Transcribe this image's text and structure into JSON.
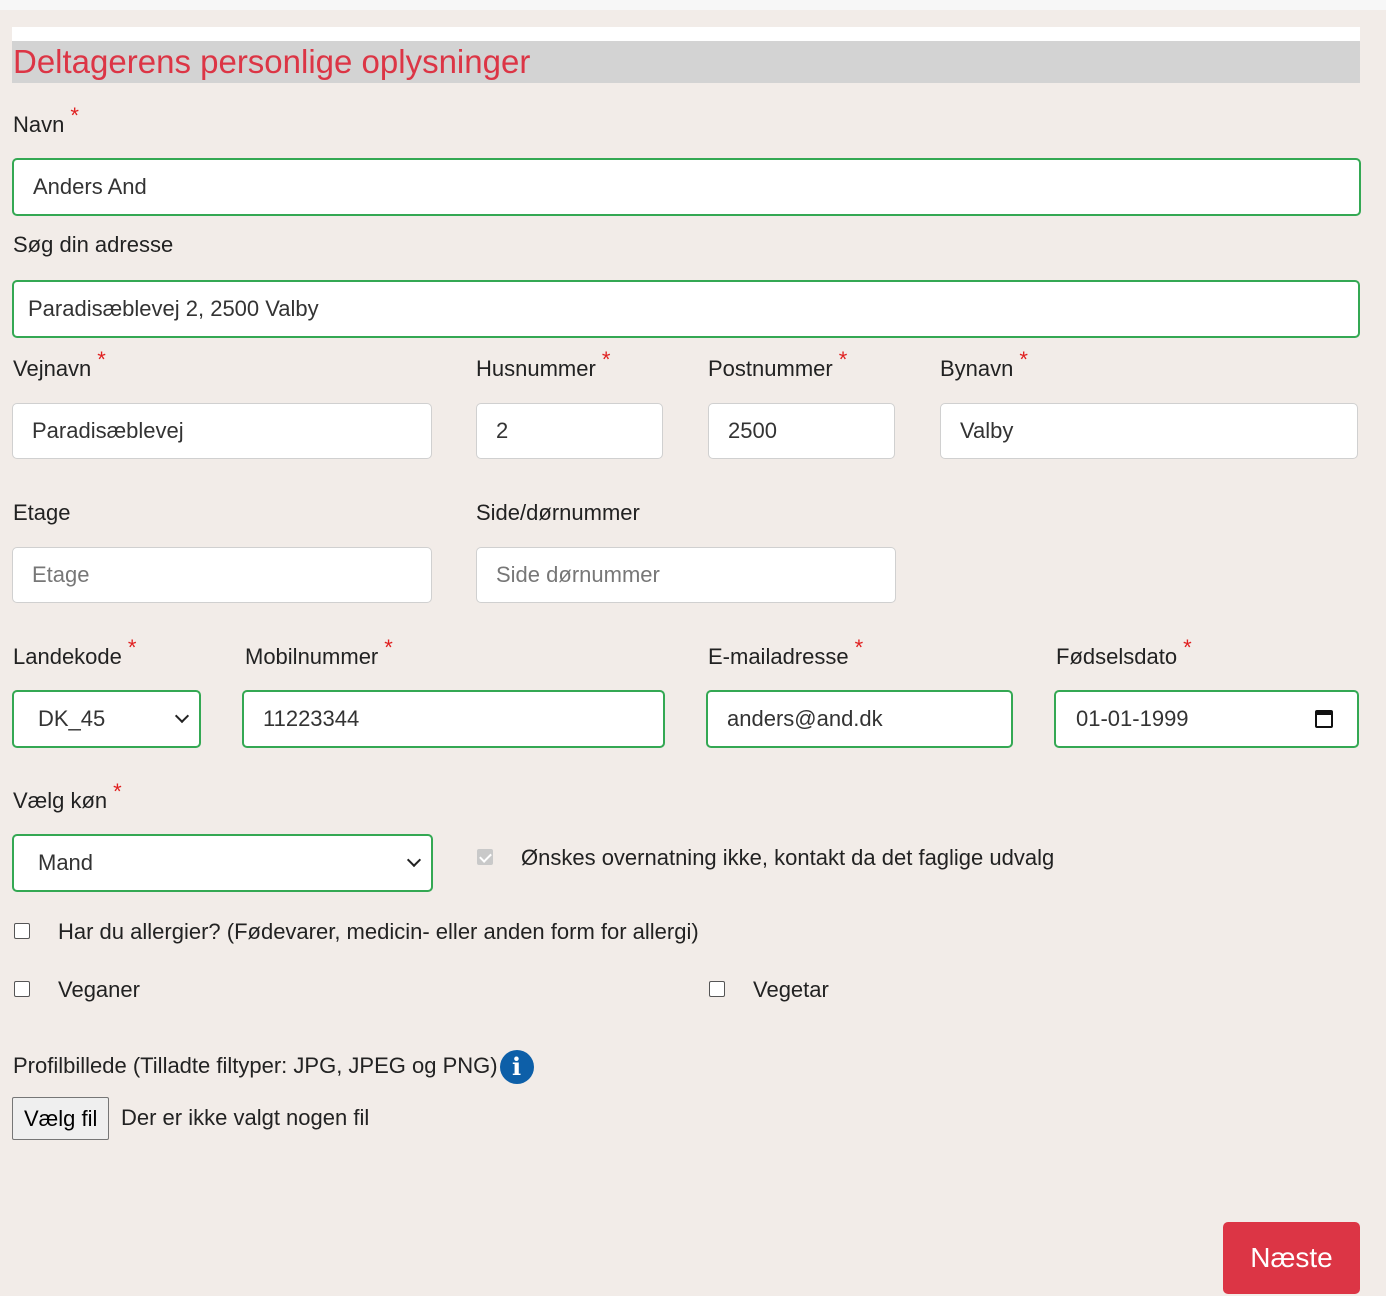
{
  "header": {
    "title": "Deltagerens personlige oplysninger"
  },
  "required_marker": "*",
  "fields": {
    "navn": {
      "label": "Navn",
      "value": "Anders And"
    },
    "adresse_search": {
      "label": "Søg din adresse",
      "value": "Paradisæblevej 2, 2500 Valby"
    },
    "vejnavn": {
      "label": "Vejnavn",
      "value": "Paradisæblevej"
    },
    "husnummer": {
      "label": "Husnummer",
      "value": "2"
    },
    "postnummer": {
      "label": "Postnummer",
      "value": "2500"
    },
    "bynavn": {
      "label": "Bynavn",
      "value": "Valby"
    },
    "etage": {
      "label": "Etage",
      "placeholder": "Etage"
    },
    "side": {
      "label": "Side/dørnummer",
      "placeholder": "Side dørnummer"
    },
    "landekode": {
      "label": "Landekode",
      "value": "DK_45"
    },
    "mobil": {
      "label": "Mobilnummer",
      "value": "11223344"
    },
    "email": {
      "label": "E-mailadresse",
      "value": "anders@and.dk"
    },
    "fodselsdato": {
      "label": "Fødselsdato",
      "value": "01-01-1999"
    },
    "kon": {
      "label": "Vælg køn",
      "value": "Mand"
    }
  },
  "checkboxes": {
    "overnatning": {
      "label": "Ønskes overnatning ikke, kontakt da det faglige udvalg",
      "checked": true
    },
    "allergier": {
      "label": "Har du allergier? (Fødevarer, medicin- eller anden form for allergi)",
      "checked": false
    },
    "veganer": {
      "label": "Veganer",
      "checked": false
    },
    "vegetar": {
      "label": "Vegetar",
      "checked": false
    }
  },
  "profile": {
    "label": "Profilbillede (Tilladte filtyper: JPG, JPEG og PNG)",
    "button": "Vælg fil",
    "status": "Der er ikke valgt nogen fil",
    "info_glyph": "i"
  },
  "next_button": "Næste",
  "colors": {
    "accent": "#dc3545",
    "valid_border": "#34a853",
    "info": "#0d5fa8"
  }
}
